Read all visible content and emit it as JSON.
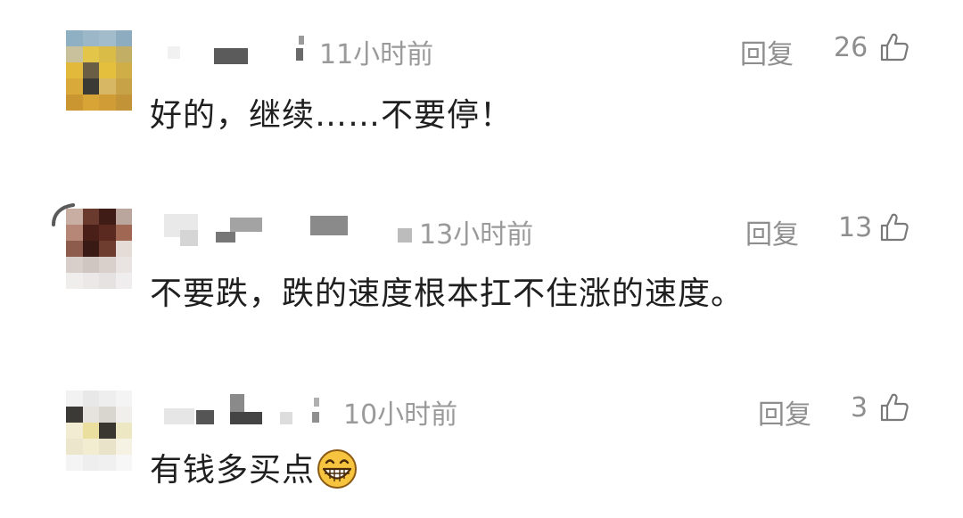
{
  "comments": [
    {
      "time": "11小时前",
      "reply_label": "回复",
      "likes": "26",
      "text": "好的，继续……不要停！",
      "icons": {
        "like": "thumbs-up-icon"
      }
    },
    {
      "time": "13小时前",
      "reply_label": "回复",
      "likes": "13",
      "text": "不要跌，跌的速度根本扛不住涨的速度。",
      "icons": {
        "like": "thumbs-up-icon"
      }
    },
    {
      "time": "10小时前",
      "reply_label": "回复",
      "likes": "3",
      "text": "有钱多买点",
      "emoji": "grinning-face-emoji",
      "icons": {
        "like": "thumbs-up-icon"
      }
    }
  ],
  "colors": {
    "time_text": "#9a9a9a",
    "action_text": "#8e8e8e",
    "body_text": "#1f1f1f"
  }
}
